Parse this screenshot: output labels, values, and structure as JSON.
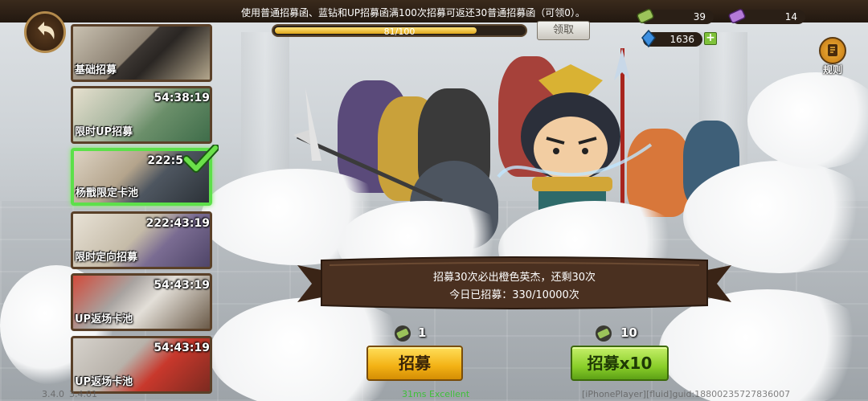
{
  "top": {
    "notice": "使用普通招募函、蓝钻和UP招募函满100次招募可返还30普通招募函（可领0）。",
    "progress_text": "81/100",
    "progress_fraction": 0.81,
    "claim_label": "领取"
  },
  "currencies": [
    {
      "icon": "scroll-icon",
      "value": "39"
    },
    {
      "icon": "purple-scroll-icon",
      "value": "14"
    },
    {
      "icon": "blue-diamond-icon",
      "value": "1636"
    }
  ],
  "rules_label": "规则",
  "pools": [
    {
      "label": "基础招募",
      "timer": ""
    },
    {
      "label": "限时UP招募",
      "timer": "54:38:19"
    },
    {
      "label": "杨戬限定卡池",
      "timer": "222:5"
    },
    {
      "label": "限时定向招募",
      "timer": "222:43:19"
    },
    {
      "label": "UP返场卡池",
      "timer": "54:43:19"
    },
    {
      "label": "UP返场卡池",
      "timer": "54:43:19"
    }
  ],
  "banner": {
    "line1": "招募30次必出橙色英杰，还剩30次",
    "line2": "今日已招募：330/10000次"
  },
  "recruit": {
    "single_cost": "1",
    "single_label": "招募",
    "multi_cost": "10",
    "multi_label": "招募x10"
  },
  "debug": {
    "version_a": "3.4.0",
    "version_b": "3.4.01",
    "fps": "31ms  Excellent",
    "player": "[iPhonePlayer][fluid]guid:18800235727836007"
  },
  "colors": {
    "active_border": "#5de04a",
    "gold_button": "#f3b114",
    "green_button": "#8acf2a",
    "banner_wood": "#4a3020"
  }
}
